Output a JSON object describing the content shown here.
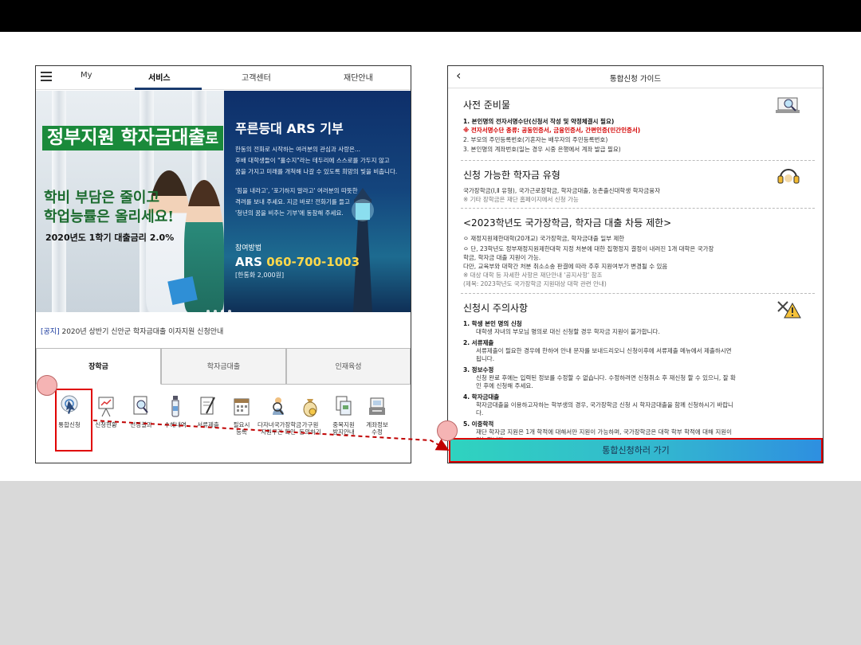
{
  "left": {
    "nav": {
      "tabs": [
        "My",
        "서비스",
        "고객센터",
        "재단안내"
      ],
      "active": "서비스"
    },
    "banner": {
      "title_main": "정부지원 학자금대출",
      "title_suffix": "로",
      "sub1": "학비 부담은 줄이고",
      "sub2": "학업능률은 올리세요!",
      "rate": "2020년도 1학기 대출금리 2.0%",
      "ars_title": "푸른등대 ARS 기부",
      "ars_lines": [
        "한동의 전화로 시작하는 여러분의 관심과 사랑은...",
        "후배 대학생들이 \"홀수지\"라는 테두리에 스스로를 가두지 않고",
        "꿈을 가지고 미래를 개척해 나갈 수 있도록 희망의 빛을 비춥니다.",
        "'힘을 내라고', '포기하지 말라고' 여러분의 따뜻한",
        "격려를 보내 주세요. 지금 바로! 전화기를 들고",
        "'청년의 꿈을 비추는 기부'에 동참해 주세요."
      ],
      "ars_how": "참여방법",
      "ars_number_prefix": "ARS",
      "ars_number": "060-700-1003",
      "ars_fee": "[한통화 2,000원]"
    },
    "notice_tag": "[공지]",
    "notice_text": "2020년 상반기 신안군 학자금대출 이자지원 신청안내",
    "tabs": [
      "장학금",
      "학자금대출",
      "인재육성"
    ],
    "menu": [
      {
        "label": "통합신청",
        "icon": "cursor-click-icon"
      },
      {
        "label": "신청현황",
        "icon": "presentation-board-icon"
      },
      {
        "label": "선정결과",
        "icon": "magnifier-document-icon"
      },
      {
        "label": "수혜내역",
        "icon": "bottle-icon"
      },
      {
        "label": "서류제출",
        "icon": "pen-document-icon"
      },
      {
        "label": "필요시\n등록",
        "icon": "calendar-icon"
      },
      {
        "label": "다자녀국가장학금\n지원구간 확인",
        "icon": "search-person-icon"
      },
      {
        "label": "가구원\n동의하기",
        "icon": "coin-bag-icon"
      },
      {
        "label": "중복지원\n방지안내",
        "icon": "documents-icon"
      },
      {
        "label": "계좌정보\n수정",
        "icon": "register-icon"
      }
    ]
  },
  "right": {
    "title": "통합신청 가이드",
    "sections": {
      "prep": {
        "title": "사전 준비물",
        "icon": "laptop-search-icon",
        "items": [
          "1.  본인명의 전자서명수단(신청서 작성 및 약정체결시 필요)",
          "      ※ 전자서명수단 종류: 공동인증서, 금융인증서, 간편인증(민간인증서)",
          "2.  부모의 주민등록번호(기혼자는 배우자의 주민등록번호)",
          "3.  본인명의 계좌번호(일는 경우 시중 은행에서 계좌 발급 필요)"
        ]
      },
      "types": {
        "title": "신청 가능한 학자금 유형",
        "icon": "headset-icon",
        "items": [
          "국가장학금(Ⅰ,Ⅱ 유형), 국가근로장학금, 학자금대출, 농촌출신대학생 학자금융자",
          "※ 기타 장학금은 재단 홈페이지에서 신청 가능"
        ]
      },
      "limit": {
        "title": "<2023학년도 국가장학금, 학자금 대출 차등 제한>",
        "items": [
          "ㅇ 재정지원제한대학(20개교) 국가장학금, 학자금대출 일부 제한",
          "ㅇ 단, 23학년도 정부재정지원제한대학 지정 처분에 대한 집행정지 결정이 내려진 1개 대학은 국가장",
          "    학금, 학자금 대출 지원이 가능.",
          "    다만, 교육부와 대학간 처분 취소소송 판결에 따라 추후 지원여부가 변경될 수 있음",
          "※ 대상 대학 등 자세한 사항은 재단안내 '공지사항'  참조",
          "    (제목: 2023학년도 국가장학금 지원대상 대학 관련 안내)"
        ]
      },
      "notes": {
        "title": "신청시 주의사항",
        "icon": "warning-tools-icon",
        "items": [
          {
            "head": "1.  학생 본인 명의 신청",
            "body": [
              "대학생 자녀의 부모님 명의로 대신 신청할 경우 학자금 지원이 불가합니다."
            ]
          },
          {
            "head": "2.  서류제출",
            "body": [
              "서류제출이 필요한 경우에 한하여 안내 문자를 보내드리오니 신청이후에 서류제출 메뉴에서 제출하시면",
              "됩니다."
            ]
          },
          {
            "head": "3.  정보수정",
            "body": [
              "신청 완료 후에는 입력된 정보를 수정할 수 없습니다. 수정하려면 신청취소 후 재신청 할 수 있으니, 잘 확",
              "인 후에 신청해 주세요."
            ]
          },
          {
            "head": "4.  학자금대출",
            "body": [
              "학자금대출을 이용하고자하는 학부생의 경우, 국가장학금 신청 시 학자금대출을 함께 신청하시기 바랍니",
              "다."
            ]
          },
          {
            "head": "5.  이중학적",
            "body": [
              "재단 학자금 지원은 1개 학적에 대해서만 지원이 가능하며, 국가장학금은 대학 학부 학적에 대해 지원이",
              "가능합니다."
            ]
          }
        ]
      }
    },
    "cta": "통합신청하러 가기"
  },
  "colors": {
    "topbar": "#000000",
    "bottom": "#d9d9d9",
    "highlight": "#e00000",
    "cta_start": "#2fd3bf",
    "cta_end": "#2e8fe0",
    "banner_green": "#1a8a3b",
    "ars_yellow": "#ffd84a"
  }
}
